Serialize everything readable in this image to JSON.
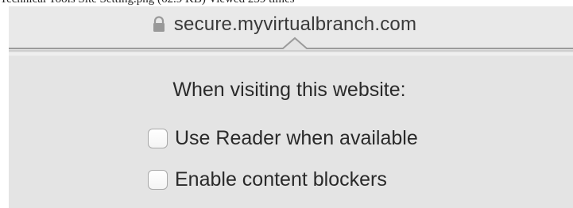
{
  "caption": "Technical Tools Site Setting.png (62.9 KB) Viewed 259 times",
  "address_bar": {
    "lock_icon": "lock-icon",
    "url": "secure.myvirtualbranch.com"
  },
  "popover": {
    "title": "When visiting this website:",
    "options": [
      {
        "label": "Use Reader when available",
        "checked": false
      },
      {
        "label": "Enable content blockers",
        "checked": false
      }
    ]
  },
  "colors": {
    "background": "#e4e4e4",
    "text": "#2a2a2a",
    "checkbox_border": "#a8a8a8"
  }
}
